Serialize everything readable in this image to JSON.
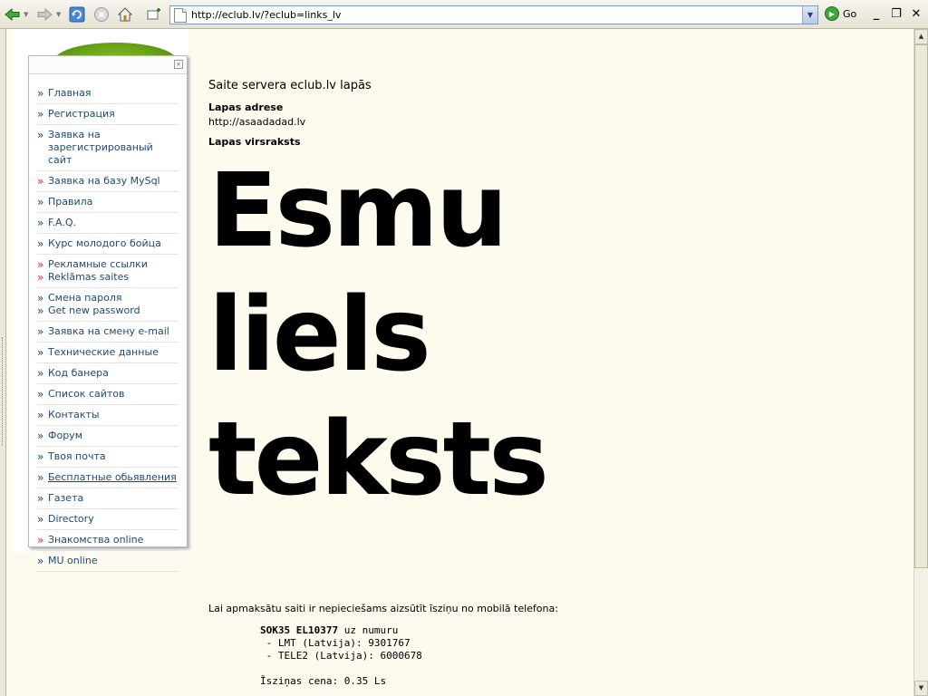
{
  "browser": {
    "address": "http://eclub.lv/?eclub=links_lv",
    "go_label": "Go",
    "icons": [
      "back-icon",
      "forward-icon",
      "refresh-icon",
      "stop-icon",
      "home-icon",
      "favorites-add-icon",
      "page-icon",
      "go-icon"
    ],
    "window_buttons": [
      "_",
      "❐",
      "✕"
    ]
  },
  "sidebar": {
    "items": [
      {
        "label": "Главная"
      },
      {
        "label": "Регистрация"
      },
      {
        "label": "Заявка на зарегистрированый сайт"
      },
      {
        "label": "Заявка на базу MySql"
      },
      {
        "label": "Правила"
      },
      {
        "label": "F.A.Q."
      },
      {
        "label": "Курс молодого бойца"
      },
      {
        "label": "Рекламные ссылки",
        "label2": "Reklāmas saites"
      },
      {
        "label": "Смена пароля",
        "label2": "Get new password"
      },
      {
        "label": "Заявка на смену e-mail"
      },
      {
        "label": "Технические данные"
      },
      {
        "label": "Код банера"
      },
      {
        "label": "Список сайтов"
      },
      {
        "label": "Контакты"
      },
      {
        "label": "Форум"
      },
      {
        "label": "Твоя почта"
      },
      {
        "label": "Бесплатные обьявления"
      },
      {
        "label": "Газета"
      },
      {
        "label": "Directory"
      },
      {
        "label": "Знакомства online"
      },
      {
        "label": "MU online"
      }
    ]
  },
  "main": {
    "heading": "Saite servera eclub.lv lapās",
    "address_label": "Lapas adrese",
    "address_value": "http://asaadadad.lv",
    "title_label": "Lapas virsraksts",
    "big_lines": [
      "Esmu",
      "liels",
      "teksts"
    ]
  },
  "payment": {
    "intro": "Lai apmaksātu saiti ir nepieciešams aizsūtīt īsziņu no mobilā telefona:",
    "sms_code": "SOK35 EL10377",
    "sms_suffix": " uz numuru",
    "lmt": " - LMT (Latvija): 9301767",
    "tele2": " - TELE2 (Latvija): 6000678",
    "price": "Īsziņas cena: 0.35 Ls"
  },
  "colors": {
    "page_bg": "#fdfaee",
    "link": "#214a73",
    "bullet_red": "#d03030",
    "logo_green": "#7ab51d"
  }
}
